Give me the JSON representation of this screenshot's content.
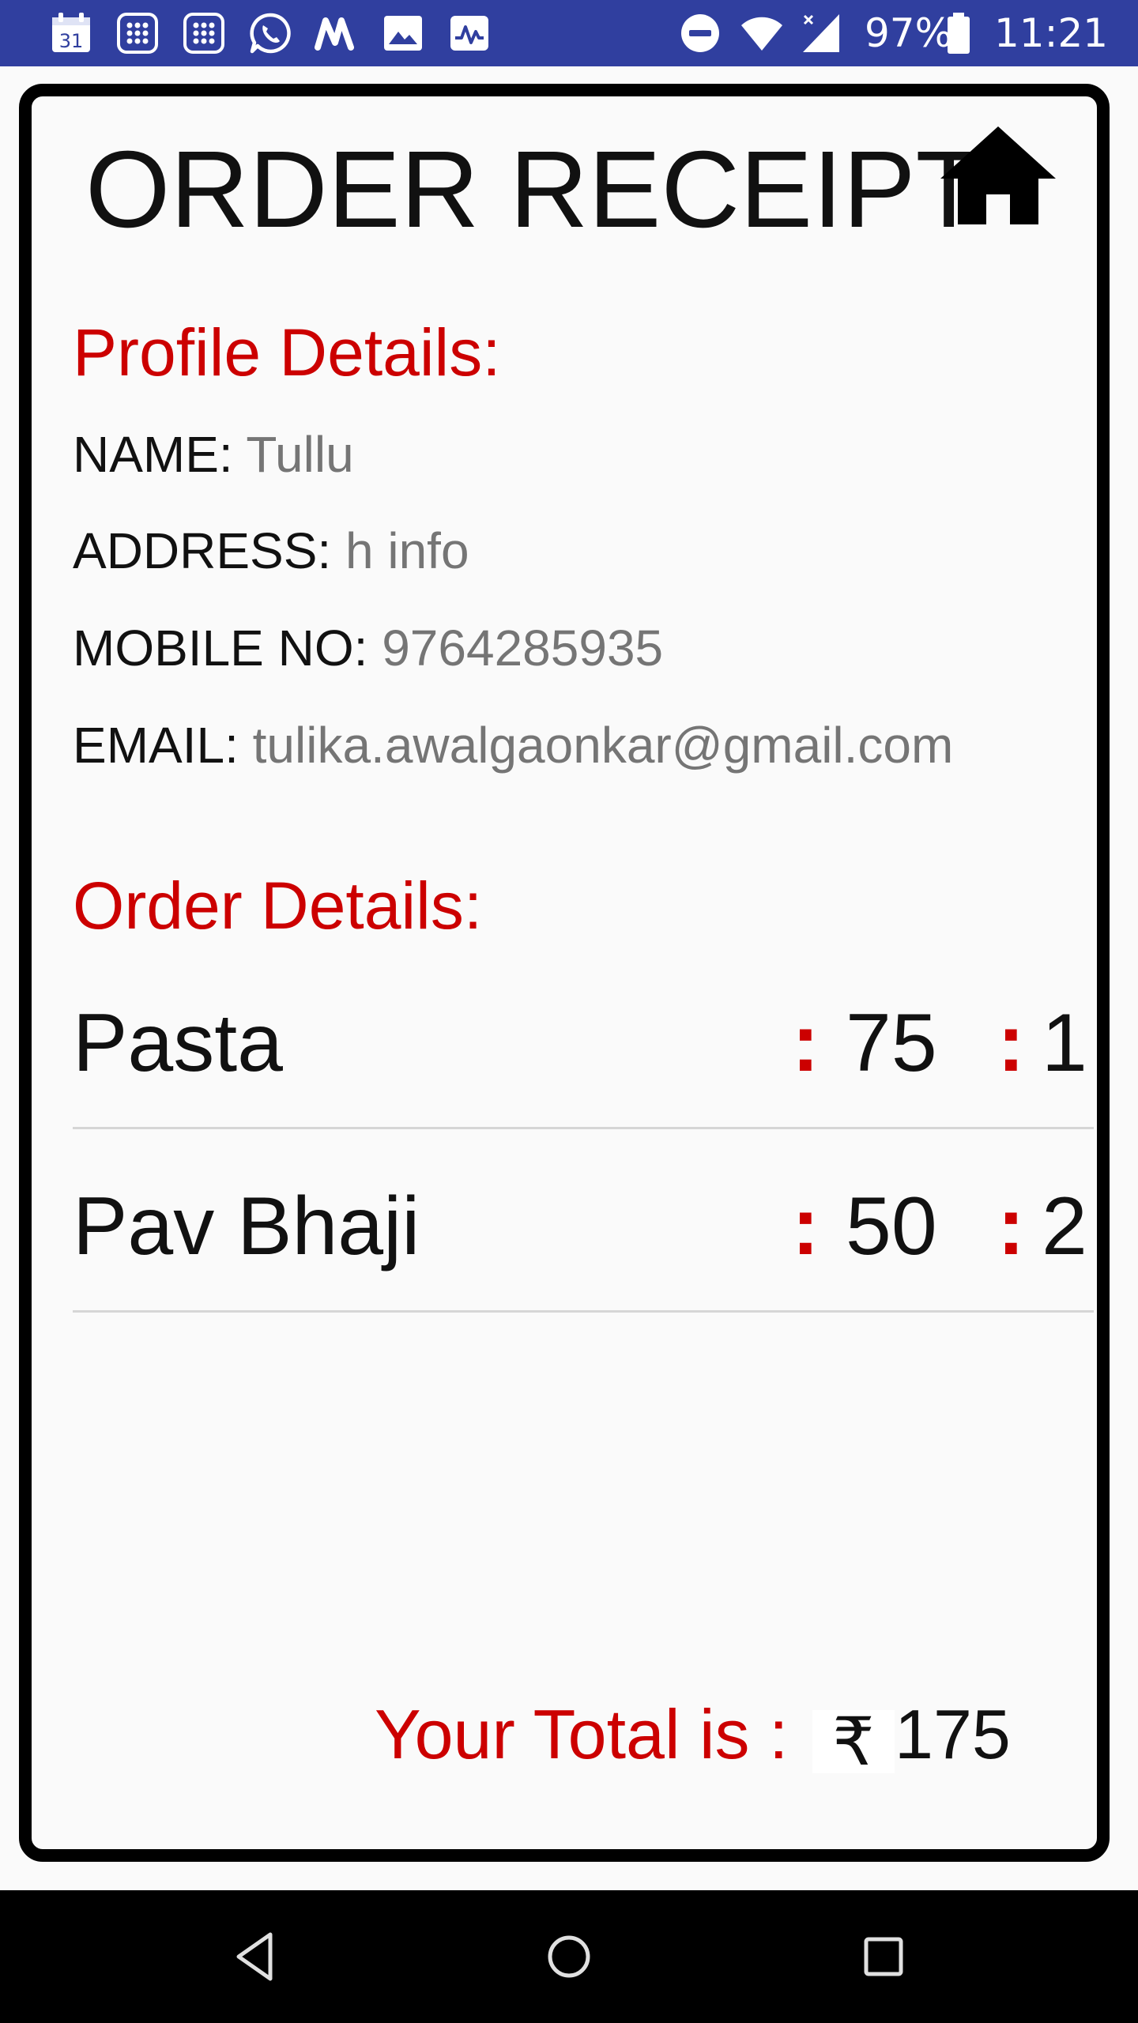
{
  "status_bar": {
    "calendar_day": "31",
    "battery_percent": "97%",
    "time": "11:21",
    "background_color": "#303f9f",
    "left_icons": [
      "calendar-icon",
      "grid-app-icon",
      "grid-app-icon",
      "whatsapp-icon",
      "m-app-icon",
      "image-icon",
      "activity-chart-icon"
    ],
    "right_icons": [
      "do-not-disturb-icon",
      "wifi-icon",
      "cellular-signal-icon",
      "battery-icon"
    ]
  },
  "receipt": {
    "title": "ORDER RECEIPT",
    "home_icon": "home-icon",
    "accent_color": "#cc0000",
    "profile": {
      "heading": "Profile Details:",
      "name_label": "NAME:",
      "name_value": "Tullu",
      "address_label": "ADDRESS:",
      "address_value": "h info",
      "mobile_label": "MOBILE NO:",
      "mobile_value": "9764285935",
      "email_label": "EMAIL:",
      "email_value": "tulika.awalgaonkar@gmail.com"
    },
    "order": {
      "heading": "Order Details:",
      "separator": ":",
      "items": [
        {
          "name": "Pasta",
          "price": "75",
          "qty": "1"
        },
        {
          "name": "Pav Bhaji",
          "price": "50",
          "qty": "2"
        }
      ]
    },
    "total": {
      "label": "Your Total is :",
      "currency": "₹",
      "value": "175"
    }
  },
  "nav_bar": {
    "buttons": [
      "back-icon",
      "home-circle-icon",
      "recents-icon"
    ]
  }
}
